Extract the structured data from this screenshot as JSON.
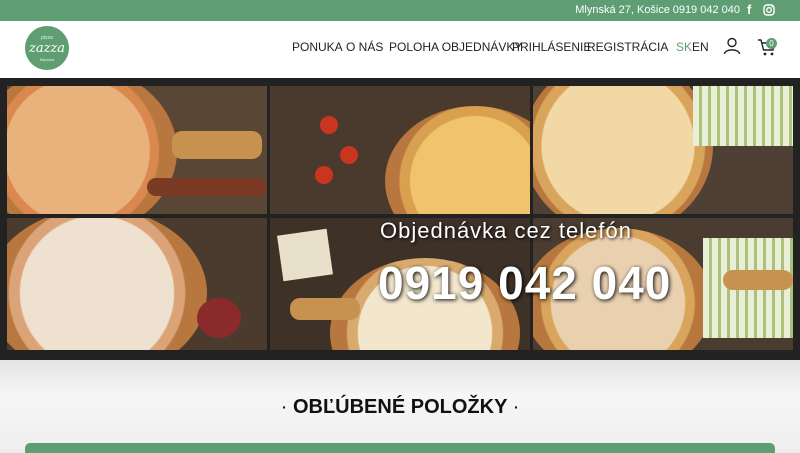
{
  "topbar": {
    "address": "Mlynská 27, Košice",
    "phone": "0919 042 040",
    "social": [
      "facebook-icon",
      "instagram-icon"
    ]
  },
  "logo": {
    "line1": "pizza",
    "line2": "zazza",
    "line3": "Mlynská"
  },
  "nav": {
    "items": [
      "PONUKA",
      "O NÁS",
      "POLOHA OBJEDNÁVKY",
      "PRIHLÁSENIE",
      "REGISTRÁCIA"
    ]
  },
  "lang": {
    "sk": "SK",
    "en": "EN"
  },
  "cart": {
    "count": "0"
  },
  "hero": {
    "tagline": "Objednávka cez telefón",
    "phone": "0919 042 040"
  },
  "section": {
    "title": "OBĽÚBENÉ POLOŽKY",
    "dot": "·"
  },
  "colors": {
    "accent": "#5f9d73",
    "text": "#222222"
  }
}
